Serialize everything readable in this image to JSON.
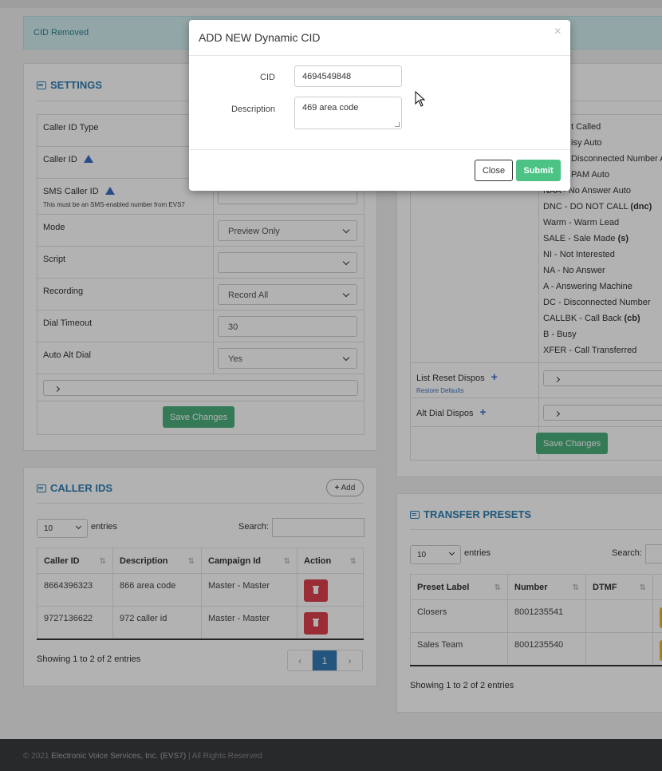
{
  "alert": {
    "text": "CID Removed"
  },
  "settings": {
    "title": "SETTINGS",
    "rows": [
      {
        "label": "Caller ID Type"
      },
      {
        "label": "Caller ID"
      },
      {
        "label": "SMS Caller ID",
        "note": "This must be an SMS-enabled number from EVS7"
      },
      {
        "label": "Mode",
        "value": "Preview Only"
      },
      {
        "label": "Script",
        "value": ""
      },
      {
        "label": "Recording",
        "value": "Record All"
      },
      {
        "label": "Dial Timeout",
        "value": "30"
      },
      {
        "label": "Auto Alt Dial",
        "value": "Yes"
      }
    ],
    "save_label": "Save Changes"
  },
  "dispos": {
    "items": [
      {
        "code": "NC - Not Called",
        "partial": "t Called"
      },
      {
        "code": "B - Busy Auto",
        "partial": "isy Auto"
      },
      {
        "code": "DC - Disconnected Number Auto",
        "partial": "Disconnected Number A"
      },
      {
        "code": "SPAM Auto",
        "partial": "PAM Auto"
      },
      {
        "code": "NAA - No Answer Auto",
        "partial": "NAA - No Answer Auto"
      },
      {
        "code": "DNC - DO NOT CALL",
        "tag": "(dnc)"
      },
      {
        "code": "Warm - Warm Lead",
        "tag": ""
      },
      {
        "code": "SALE - Sale Made",
        "tag": "(s)"
      },
      {
        "code": "NI - Not Interested",
        "tag": ""
      },
      {
        "code": "NA - No Answer",
        "tag": ""
      },
      {
        "code": "A - Answering Machine",
        "tag": ""
      },
      {
        "code": "DC - Disconnected Number",
        "tag": ""
      },
      {
        "code": "CALLBK - Call Back",
        "tag": "(cb)"
      },
      {
        "code": "B - Busy",
        "tag": ""
      },
      {
        "code": "XFER - Call Transferred",
        "tag": ""
      }
    ],
    "list_reset_label": "List Reset Dispos",
    "restore_defaults": "Restore Defaults",
    "alt_dial_label": "Alt Dial Dispos",
    "save_label": "Save Changes"
  },
  "caller_ids": {
    "title": "CALLER IDS",
    "add_label": "Add",
    "page_size": "10",
    "entries_label": "entries",
    "search_label": "Search:",
    "headers": [
      "Caller ID",
      "Description",
      "Campaign Id",
      "Action"
    ],
    "rows": [
      {
        "cid": "8664396323",
        "desc": "866 area code",
        "campaign": "Master - Master"
      },
      {
        "cid": "9727136622",
        "desc": "972 caller id",
        "campaign": "Master - Master"
      }
    ],
    "showing": "Showing 1 to 2 of 2 entries",
    "pager": {
      "prev": "‹",
      "page": "1",
      "next": "›"
    }
  },
  "transfer_presets": {
    "title": "TRANSFER PRESETS",
    "page_size": "10",
    "entries_label": "entries",
    "search_label": "Search:",
    "headers": [
      "Preset Label",
      "Number",
      "DTMF"
    ],
    "rows": [
      {
        "label": "Closers",
        "number": "8001235541",
        "dtmf": ""
      },
      {
        "label": "Sales Team",
        "number": "8001235540",
        "dtmf": ""
      }
    ],
    "showing": "Showing 1 to 2 of 2 entries"
  },
  "footer": {
    "copyright": "© 2021",
    "company": "Electronic Voice Services, Inc. (EVS7)",
    "rights": "| All Rights Reserved"
  },
  "modal": {
    "title": "ADD NEW Dynamic CID",
    "close_x": "×",
    "cid_label": "CID",
    "cid_value": "4694549848",
    "desc_label": "Description",
    "desc_value": "469 area code",
    "close_label": "Close",
    "submit_label": "Submit"
  },
  "colors": {
    "accent": "#2f7fb3",
    "green": "#4caf7d",
    "danger": "#dc3f4d",
    "primary": "#337ab7"
  }
}
